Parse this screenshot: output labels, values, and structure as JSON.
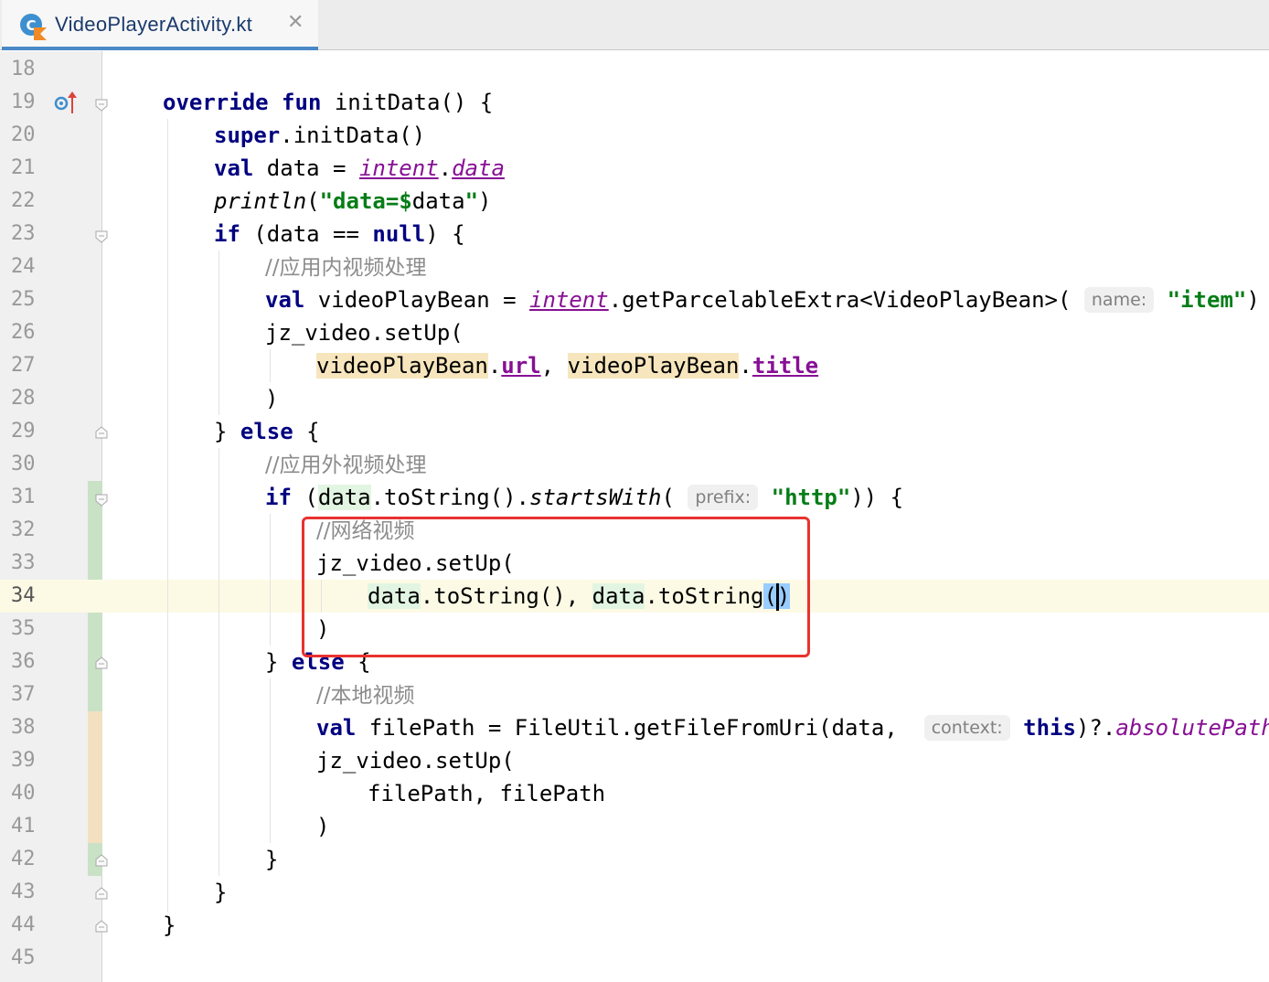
{
  "tab": {
    "file_name": "VideoPlayerActivity.kt",
    "close_glyph": "✕",
    "icon": "kotlin-class-file-icon"
  },
  "colors": {
    "keyword": "#000080",
    "string": "#067d17",
    "comment": "#8c8c8c",
    "property": "#871094",
    "caret_row": "#fcfae5",
    "highlight_box": "#e8322e",
    "tab_underline": "#4a88c7",
    "change_added": "#c9e2c6",
    "change_modified": "#f3e0c0"
  },
  "gutter": {
    "line_numbers": [
      "18",
      "19",
      "20",
      "21",
      "22",
      "23",
      "24",
      "25",
      "26",
      "27",
      "28",
      "29",
      "30",
      "31",
      "32",
      "33",
      "34",
      "35",
      "36",
      "37",
      "38",
      "39",
      "40",
      "41",
      "42",
      "43",
      "44",
      "45"
    ],
    "current_line": "34",
    "override_marker_icon": "override-arrow-icon"
  },
  "code": {
    "l19": {
      "kw1": "override",
      "kw2": "fun",
      "rest": " initData() {"
    },
    "l20": {
      "kw": "super",
      "rest": ".initData()"
    },
    "l21": {
      "kw": "val",
      "mid": " data = ",
      "p1": "intent",
      "dot": ".",
      "p2": "data"
    },
    "l22": {
      "fn": "println",
      "open": "(",
      "s1": "\"data=",
      "s2": "$",
      "mid": "data",
      "s3": "\"",
      "close": ")"
    },
    "l23": {
      "kw": "if",
      "mid": " (data == ",
      "kw2": "null",
      "rest": ") {"
    },
    "l24": {
      "comment": "//应用内视频处理"
    },
    "l25": {
      "kw": "val",
      "mid": " videoPlayBean = ",
      "p1": "intent",
      "rest": ".getParcelableExtra<VideoPlayBean>(",
      "hint": "name:",
      "str": "\"item\"",
      "close": ")"
    },
    "l26": {
      "text": "jz_video.setUp("
    },
    "l27": {
      "v1": "videoPlayBean",
      "d1": ".",
      "p1": "url",
      "sep": ", ",
      "v2": "videoPlayBean",
      "d2": ".",
      "p2": "title"
    },
    "l28": {
      "text": ")"
    },
    "l29": {
      "pre": "} ",
      "kw": "else",
      "rest": " {"
    },
    "l30": {
      "comment": "//应用外视频处理"
    },
    "l31": {
      "kw": "if",
      "pre": " (",
      "v": "data",
      "mid": ".toString().",
      "fn": "startsWith",
      "open": "(",
      "hint": "prefix:",
      "str": "\"http\"",
      "rest": ")) {"
    },
    "l32": {
      "comment": "//网络视频"
    },
    "l33": {
      "text": "jz_video.setUp("
    },
    "l34": {
      "v1": "data",
      "m1": ".toString(), ",
      "v2": "data",
      "m2": ".toString",
      "paren": "()"
    },
    "l35": {
      "text": ")"
    },
    "l36": {
      "pre": "} ",
      "kw": "else",
      "rest": " {"
    },
    "l37": {
      "comment": "//本地视频"
    },
    "l38": {
      "kw": "val",
      "mid": " filePath = FileUtil.getFileFromUri(data, ",
      "hint": "context:",
      "kw2": "this",
      "rest": ")?.",
      "ext": "absolutePath"
    },
    "l39": {
      "text": "jz_video.setUp("
    },
    "l40": {
      "text": "filePath, filePath"
    },
    "l41": {
      "text": ")"
    },
    "l42": {
      "text": "}"
    },
    "l43": {
      "text": "}"
    },
    "l44": {
      "text": "}"
    }
  }
}
